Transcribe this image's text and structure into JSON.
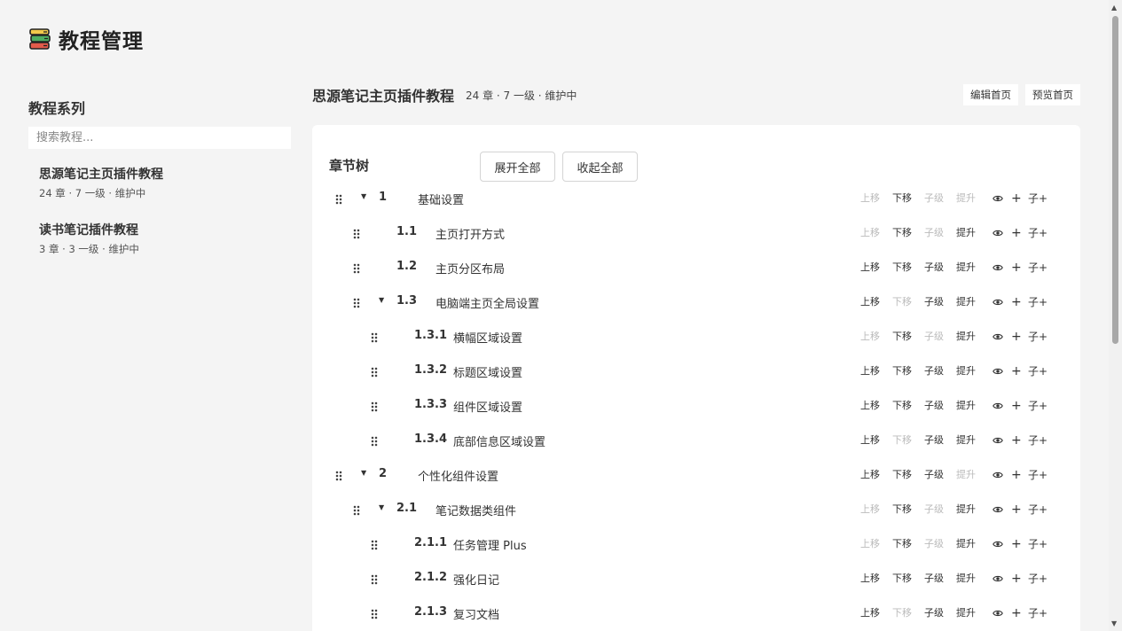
{
  "app": {
    "title": "教程管理"
  },
  "sidebar": {
    "title": "教程系列",
    "search_placeholder": "搜索教程...",
    "series": [
      {
        "name": "思源笔记主页插件教程",
        "meta": "24 章 · 7 一级 · 维护中"
      },
      {
        "name": "读书笔记插件教程",
        "meta": "3 章 · 3 一级 · 维护中"
      }
    ]
  },
  "main": {
    "title": "思源笔记主页插件教程",
    "meta": "24 章 · 7 一级 · 维护中",
    "edit_home_label": "编辑首页",
    "preview_home_label": "预览首页"
  },
  "tree": {
    "title": "章节树",
    "expand_all_label": "展开全部",
    "collapse_all_label": "收起全部",
    "action_labels": {
      "up": "上移",
      "down": "下移",
      "child": "子级",
      "promote": "提升",
      "plus": "+",
      "add_child": "子+"
    },
    "nodes": [
      {
        "num": "1",
        "title": "基础设置",
        "depth": 0,
        "expandable": true,
        "up": false,
        "down": true,
        "child": false,
        "promote": false
      },
      {
        "num": "1.1",
        "title": "主页打开方式",
        "depth": 1,
        "expandable": false,
        "up": false,
        "down": true,
        "child": false,
        "promote": true
      },
      {
        "num": "1.2",
        "title": "主页分区布局",
        "depth": 1,
        "expandable": false,
        "up": true,
        "down": true,
        "child": true,
        "promote": true
      },
      {
        "num": "1.3",
        "title": "电脑端主页全局设置",
        "depth": 1,
        "expandable": true,
        "up": true,
        "down": false,
        "child": true,
        "promote": true
      },
      {
        "num": "1.3.1",
        "title": "横幅区域设置",
        "depth": 2,
        "expandable": false,
        "up": false,
        "down": true,
        "child": false,
        "promote": true
      },
      {
        "num": "1.3.2",
        "title": "标题区域设置",
        "depth": 2,
        "expandable": false,
        "up": true,
        "down": true,
        "child": true,
        "promote": true
      },
      {
        "num": "1.3.3",
        "title": "组件区域设置",
        "depth": 2,
        "expandable": false,
        "up": true,
        "down": true,
        "child": true,
        "promote": true
      },
      {
        "num": "1.3.4",
        "title": "底部信息区域设置",
        "depth": 2,
        "expandable": false,
        "up": true,
        "down": false,
        "child": true,
        "promote": true
      },
      {
        "num": "2",
        "title": "个性化组件设置",
        "depth": 0,
        "expandable": true,
        "up": true,
        "down": true,
        "child": true,
        "promote": false
      },
      {
        "num": "2.1",
        "title": "笔记数据类组件",
        "depth": 1,
        "expandable": true,
        "up": false,
        "down": true,
        "child": false,
        "promote": true
      },
      {
        "num": "2.1.1",
        "title": "任务管理 Plus",
        "depth": 2,
        "expandable": false,
        "up": false,
        "down": true,
        "child": false,
        "promote": true
      },
      {
        "num": "2.1.2",
        "title": "强化日记",
        "depth": 2,
        "expandable": false,
        "up": true,
        "down": true,
        "child": true,
        "promote": true
      },
      {
        "num": "2.1.3",
        "title": "复习文档",
        "depth": 2,
        "expandable": false,
        "up": true,
        "down": false,
        "child": true,
        "promote": true
      }
    ]
  },
  "icons": {
    "logo": "stacked-books-icon",
    "drag": "drag-handle-icon",
    "caret": "caret-down-icon",
    "eye": "eye-icon"
  },
  "colors": {
    "background": "#f4f4f4",
    "panel": "#ffffff",
    "text": "#333333",
    "disabled": "#bbbbbb"
  }
}
